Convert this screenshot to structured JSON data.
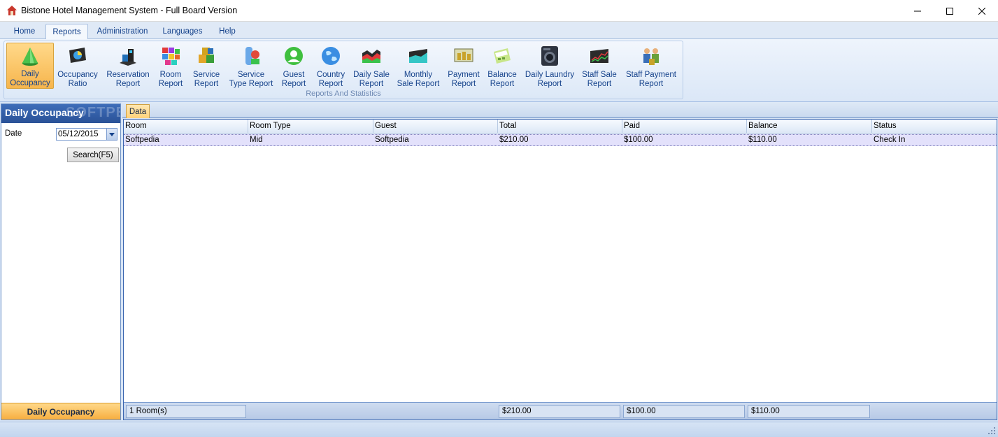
{
  "window": {
    "title": "Bistone Hotel Management System - Full Board Version",
    "icon": "house-icon",
    "controls": [
      "minimize-icon",
      "maximize-icon",
      "close-icon"
    ]
  },
  "menu": {
    "tabs": [
      {
        "label": "Home",
        "active": false
      },
      {
        "label": "Reports",
        "active": true
      },
      {
        "label": "Administration",
        "active": false
      },
      {
        "label": "Languages",
        "active": false
      },
      {
        "label": "Help",
        "active": false
      }
    ]
  },
  "ribbon": {
    "group_label": "Reports And Statistics",
    "buttons": [
      {
        "label": "Daily\nOccupancy",
        "icon": "green-cone-icon",
        "active": true
      },
      {
        "label": "Occupancy\nRatio",
        "icon": "pie-monitor-icon"
      },
      {
        "label": "Reservation\nReport",
        "icon": "building-blocks-icon"
      },
      {
        "label": "Room\nReport",
        "icon": "color-cubes-icon"
      },
      {
        "label": "Service\nReport",
        "icon": "cubes-icon"
      },
      {
        "label": "Service\nType Report",
        "icon": "blocks-icon"
      },
      {
        "label": "Guest\nReport",
        "icon": "user-icon"
      },
      {
        "label": "Country\nReport",
        "icon": "globe-icon"
      },
      {
        "label": "Daily Sale\nReport",
        "icon": "area-chart-icon"
      },
      {
        "label": "Monthly\nSale Report",
        "icon": "teal-chart-icon"
      },
      {
        "label": "Payment\nReport",
        "icon": "money-icon"
      },
      {
        "label": "Balance\nReport",
        "icon": "calculator-icon"
      },
      {
        "label": "Daily Laundry\nReport",
        "icon": "washer-icon"
      },
      {
        "label": "Staff Sale\nReport",
        "icon": "stock-chart-icon"
      },
      {
        "label": "Staff Payment\nReport",
        "icon": "staff-icon"
      }
    ]
  },
  "left_panel": {
    "title": "Daily Occupancy",
    "watermark": "SOFTPED",
    "date_label": "Date",
    "date_value": "05/12/2015",
    "search_label": "Search(F5)",
    "footer_label": "Daily Occupancy"
  },
  "right_panel": {
    "tab_label": "Data",
    "columns": [
      "Room",
      "Room Type",
      "Guest",
      "Total",
      "Paid",
      "Balance",
      "Status"
    ],
    "rows": [
      [
        "Softpedia",
        "Mid",
        "Softpedia",
        "$210.00",
        "$100.00",
        "$110.00",
        "Check In"
      ]
    ],
    "footer": {
      "count": "1 Room(s)",
      "total": "$210.00",
      "paid": "$100.00",
      "balance": "$110.00"
    }
  },
  "colors": {
    "accent_blue": "#15428b",
    "header_blue": "#2a5297",
    "highlight_orange": "#f7b54c",
    "selected_row": "#e3e1fb"
  }
}
